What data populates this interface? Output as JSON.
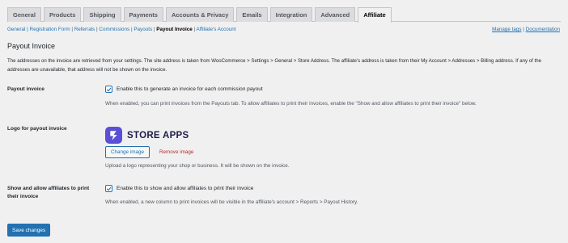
{
  "tabs": [
    "General",
    "Products",
    "Shipping",
    "Payments",
    "Accounts & Privacy",
    "Emails",
    "Integration",
    "Advanced",
    "Affiliate"
  ],
  "active_tab": "Affiliate",
  "subnav": {
    "items": [
      "General",
      "Registration Form",
      "Referrals",
      "Commissions",
      "Payouts",
      "Payout Invoice",
      "Affiliate's Account"
    ],
    "current": "Payout Invoice"
  },
  "links_right": {
    "manage_tags": "Manage tags",
    "documentation": "Documentation"
  },
  "section": {
    "title": "Payout Invoice",
    "description": "The addresses on the invoice are retrieved from your settings. The site address is taken from WooCommerce > Settings > General > Store Address. The affiliate's address is taken from their My Account > Addresses > Billing address. If any of the addresses are unavailable, that address will not be shown on the invoice."
  },
  "payout_invoice": {
    "label": "Payout invoice",
    "checkbox_label": "Enable this to generate an invoice for each commission payout",
    "checked": true,
    "help": "When enabled, you can print invoices from the Payouts tab. To allow affiliates to print their invoices, enable the \"Show and allow affiliates to print their invoice\" below."
  },
  "logo": {
    "label": "Logo for payout invoice",
    "brand_text": "STORE APPS",
    "brand_color": "#5b4fd6",
    "change_button": "Change image",
    "remove_link": "Remove image",
    "help": "Upload a logo representing your shop or business. It will be shown on the invoice."
  },
  "show_allow": {
    "label": "Show and allow affiliates to print their invoice",
    "checkbox_label": "Enable this to show and allow affiliates to print their invoice",
    "checked": true,
    "help": "When enabled, a new column to print invoices will be visible in the affiliate's account > Reports > Payout History."
  },
  "save_button": "Save changes",
  "colors": {
    "accent": "#2271b1",
    "danger": "#b32d2e",
    "background": "#f0f0f1"
  }
}
